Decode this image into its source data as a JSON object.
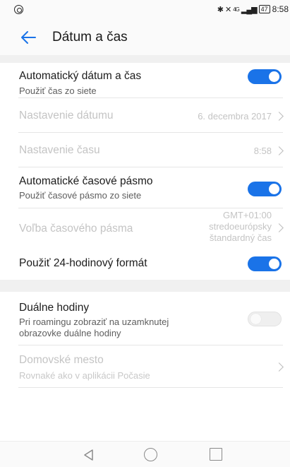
{
  "status_bar": {
    "icons": [
      "circle-notification-icon",
      "bluetooth-icon",
      "mute-icon",
      "signal-icon"
    ],
    "network": "4G",
    "battery": "47",
    "time": "8:58"
  },
  "header": {
    "back_icon": "arrow-left-icon",
    "title": "Dátum a čas"
  },
  "settings": {
    "auto_date": {
      "label": "Automatický dátum a čas",
      "subtitle": "Použiť čas zo siete",
      "enabled": true
    },
    "set_date": {
      "label": "Nastavenie dátumu",
      "value": "6. decembra 2017"
    },
    "set_time": {
      "label": "Nastavenie času",
      "value": "8:58"
    },
    "auto_timezone": {
      "label": "Automatické časové pásmo",
      "subtitle": "Použiť časové pásmo zo siete",
      "enabled": true
    },
    "timezone": {
      "label": "Voľba časového pásma",
      "value_line1": "GMT+01:00",
      "value_line2": "stredoeurópsky",
      "value_line3": "štandardný čas"
    },
    "format_24h": {
      "label": "Použiť 24-hodinový formát",
      "enabled": true
    },
    "dual_clock": {
      "label": "Duálne hodiny",
      "subtitle_line1": "Pri roamingu zobraziť na uzamknutej",
      "subtitle_line2": "obrazovke duálne hodiny",
      "enabled": false
    },
    "home_city": {
      "label": "Domovské mesto",
      "subtitle": "Rovnaké ako v aplikácii Počasie"
    }
  },
  "colors": {
    "accent": "#1a73e8",
    "disabled_text": "#c4c4c4",
    "background": "#fafafa"
  },
  "nav_bar": {
    "buttons": [
      "triangle-back-icon",
      "circle-home-icon",
      "square-recents-icon"
    ]
  }
}
